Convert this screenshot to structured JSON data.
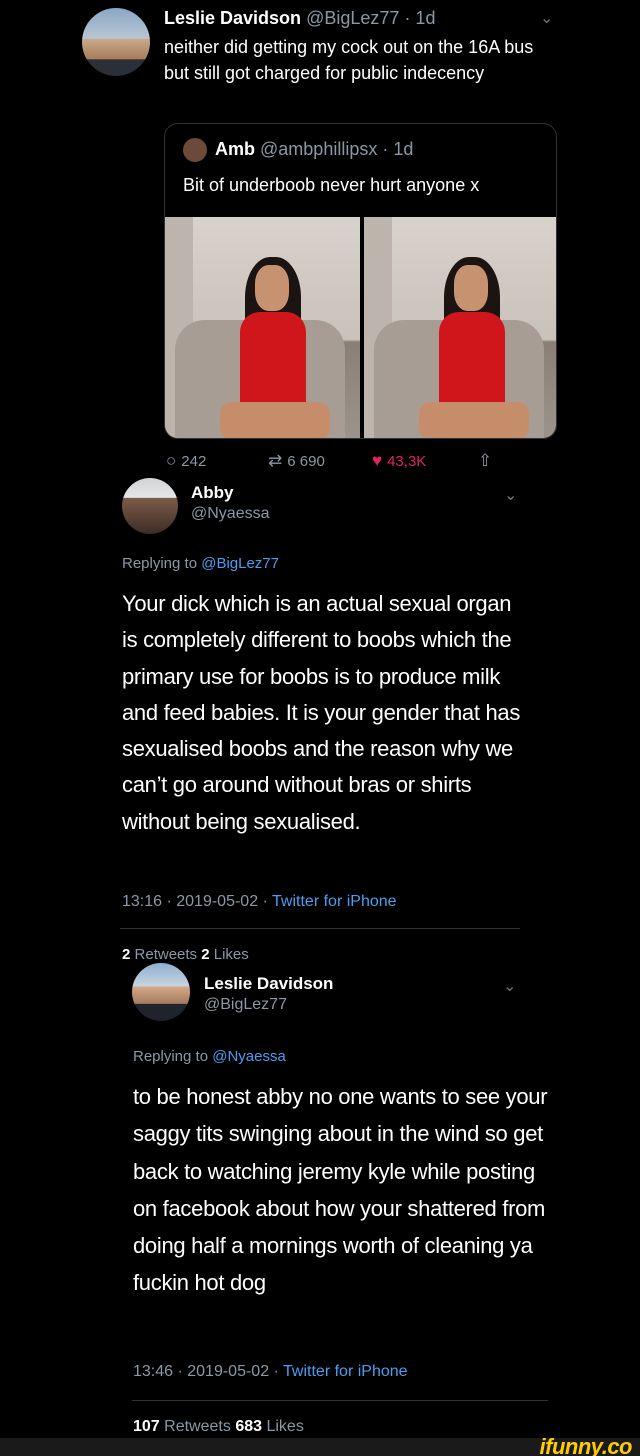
{
  "tweet1": {
    "name": "Leslie Davidson",
    "handle": "@BigLez77",
    "time": "· 1d",
    "text": "neither did getting my cock out on the 16A bus but still got charged for public indecency",
    "quote": {
      "name": "Amb",
      "handle": "@ambphillipsx",
      "time": "· 1d",
      "text": "Bit of underboob never hurt anyone x"
    },
    "actions": {
      "replies": "242",
      "retweets": "6 690",
      "likes": "43,3K"
    }
  },
  "tweet2": {
    "name": "Abby",
    "handle": "@Nyaessa",
    "replying_label": "Replying to",
    "replying_to": "@BigLez77",
    "text": "Your dick which is an actual sexual organ is completely different to boobs which the primary use for boobs is to produce milk and feed babies. It is your gender that has sexualised boobs and the reason why we can’t go around without bras or shirts without being sexualised.",
    "timestamp": "13:16 · 2019-05-02 ·",
    "source": "Twitter for iPhone",
    "retweets_count": "2",
    "retweets_label": "Retweets",
    "likes_count": "2",
    "likes_label": "Likes"
  },
  "tweet3": {
    "name": "Leslie Davidson",
    "handle": "@BigLez77",
    "replying_label": "Replying to",
    "replying_to": "@Nyaessa",
    "text": "to be honest abby no one wants to see your saggy tits swinging about in the wind so get back to watching jeremy kyle while posting on facebook about how your shattered from doing half a mornings worth of cleaning ya fuckin hot dog",
    "timestamp": "13:46 · 2019-05-02 ·",
    "source": "Twitter for iPhone",
    "retweets_count": "107",
    "retweets_label": "Retweets",
    "likes_count": "683",
    "likes_label": "Likes"
  },
  "icons": {
    "chevron": "chevron-down-icon",
    "reply": "reply-icon",
    "retweet": "retweet-icon",
    "like": "heart-icon",
    "share": "share-icon"
  },
  "colors": {
    "background": "#000000",
    "link": "#4a9ef0",
    "muted": "#8b98a5",
    "like": "#e0245e",
    "watermark": "#ffcc00"
  },
  "watermark": "ifunny.co"
}
